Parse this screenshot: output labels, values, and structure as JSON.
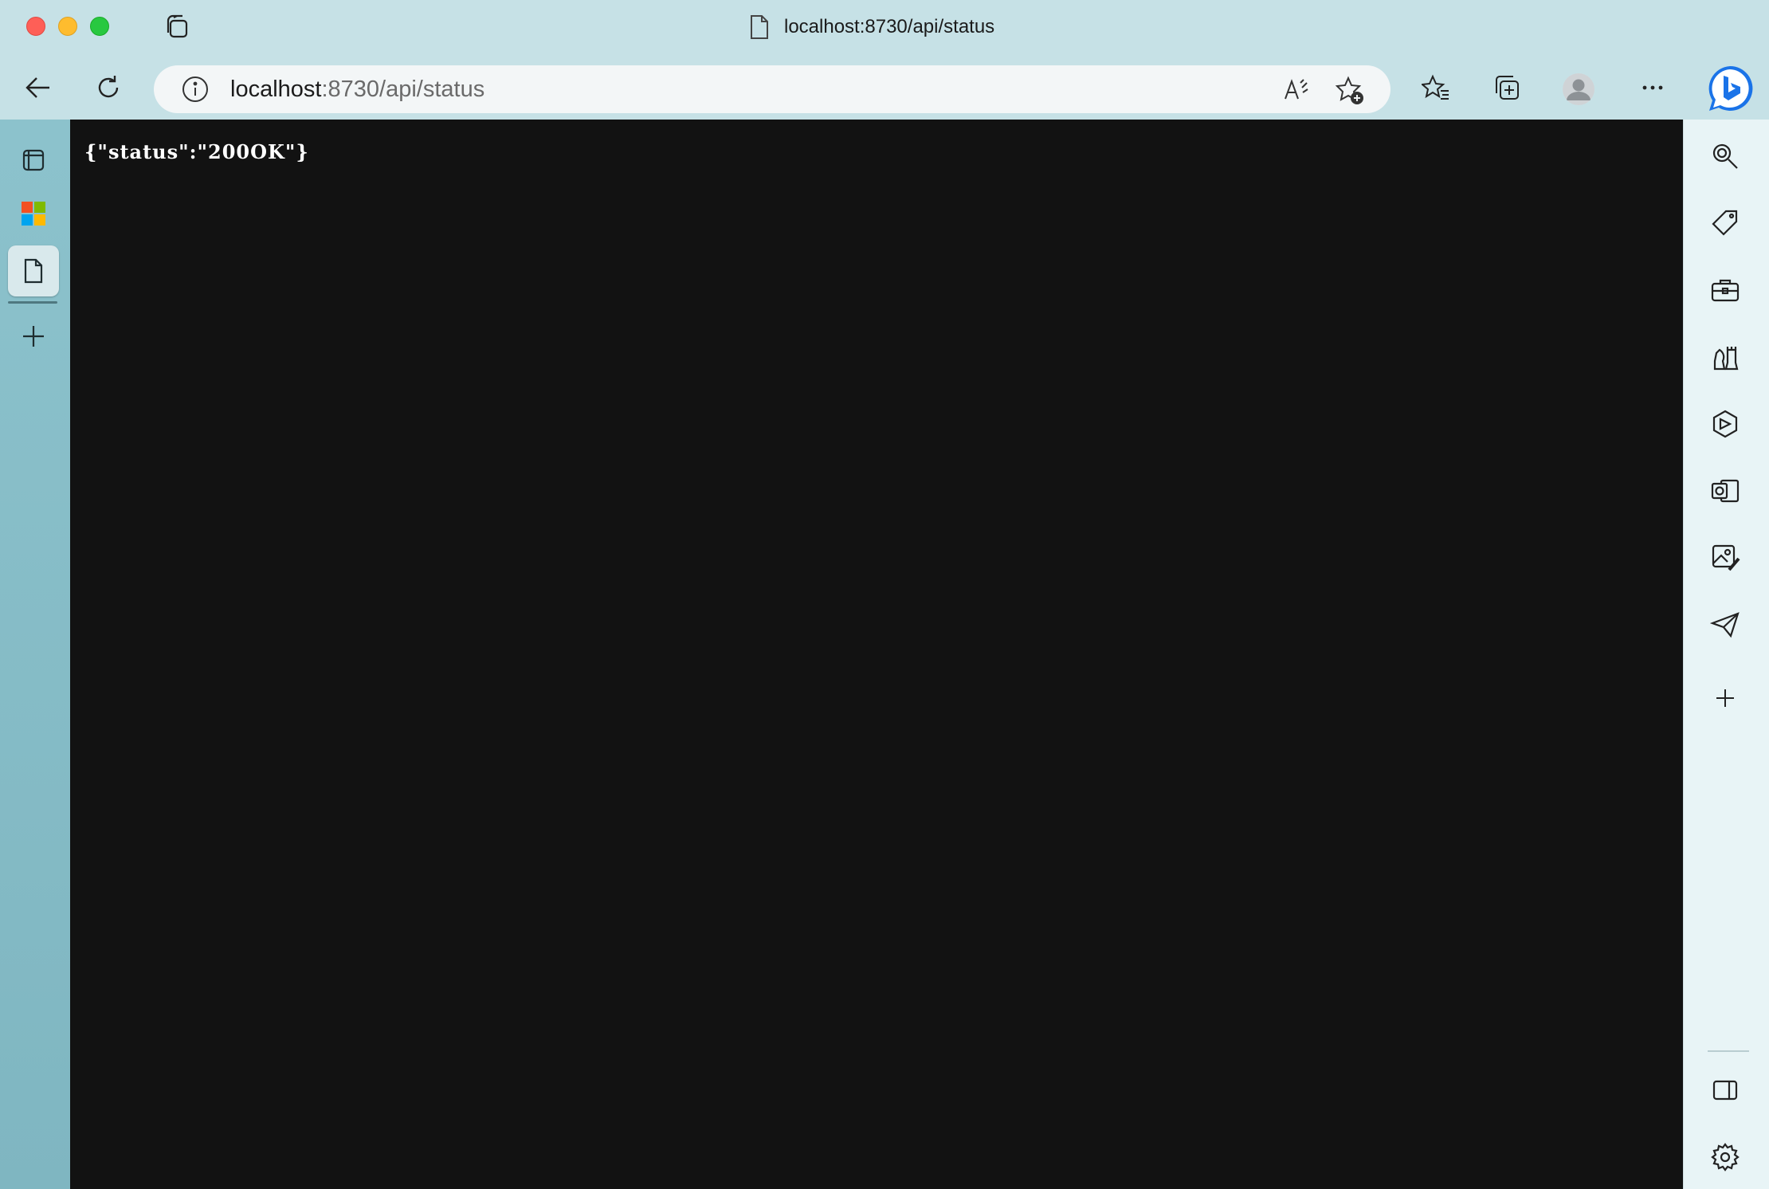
{
  "window": {
    "title": "localhost:8730/api/status"
  },
  "address_bar": {
    "host": "localhost",
    "path": ":8730/api/status"
  },
  "page": {
    "body_text": "{\"status\":\"200OK\"}"
  },
  "left_sidebar": {
    "items": [
      "tab-actions-icon",
      "microsoft-start-icon",
      "page-tab-icon",
      "new-tab-icon"
    ]
  },
  "right_sidebar": {
    "items": [
      "search-icon",
      "shopping-tag-icon",
      "tools-icon",
      "games-icon",
      "office-icon",
      "outlook-icon",
      "image-creator-icon",
      "drop-icon",
      "add-icon",
      "sidebar-toggle-icon",
      "settings-icon"
    ]
  }
}
